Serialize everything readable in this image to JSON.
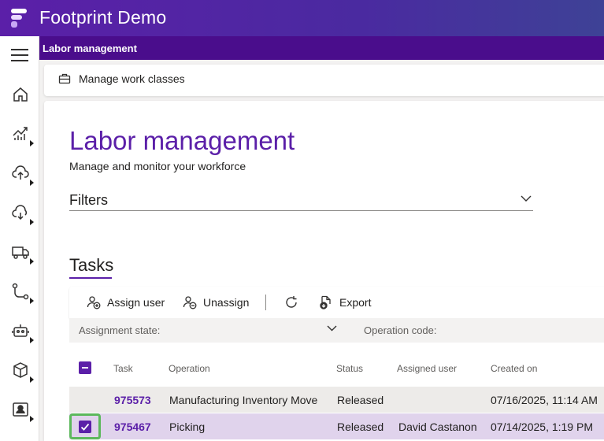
{
  "app": {
    "title": "Footprint Demo"
  },
  "header": {
    "title": "Labor management"
  },
  "actions": {
    "manage_work_classes": "Manage work classes"
  },
  "page": {
    "title": "Labor management",
    "subtitle": "Manage and monitor your workforce",
    "filters_label": "Filters"
  },
  "tasks": {
    "title": "Tasks",
    "toolbar": {
      "assign_user": "Assign user",
      "unassign": "Unassign",
      "export": "Export"
    },
    "filters": {
      "assignment_state": "Assignment state:",
      "operation_code": "Operation code:"
    },
    "columns": {
      "task": "Task",
      "operation": "Operation",
      "status": "Status",
      "assigned_user": "Assigned user",
      "created_on": "Created on"
    },
    "rows": [
      {
        "task": "975573",
        "operation": "Manufacturing Inventory Move",
        "status": "Released",
        "assigned_user": "",
        "created_on": "07/16/2025, 11:14 AM",
        "selected": false
      },
      {
        "task": "975467",
        "operation": "Picking",
        "status": "Released",
        "assigned_user": "David Castanon",
        "created_on": "07/14/2025, 1:19 PM",
        "selected": true
      }
    ]
  },
  "nav": {
    "icons": [
      "home-icon",
      "analytics-icon",
      "inbound-icon",
      "outbound-icon",
      "transport-icon",
      "workflow-icon",
      "robot-icon",
      "inventory-icon",
      "people-icon"
    ]
  },
  "colors": {
    "brand": "#5b1fa8",
    "header_strip": "#4a0d8c",
    "selected_row": "#e0d3ec",
    "focus": "#5cb85c"
  }
}
